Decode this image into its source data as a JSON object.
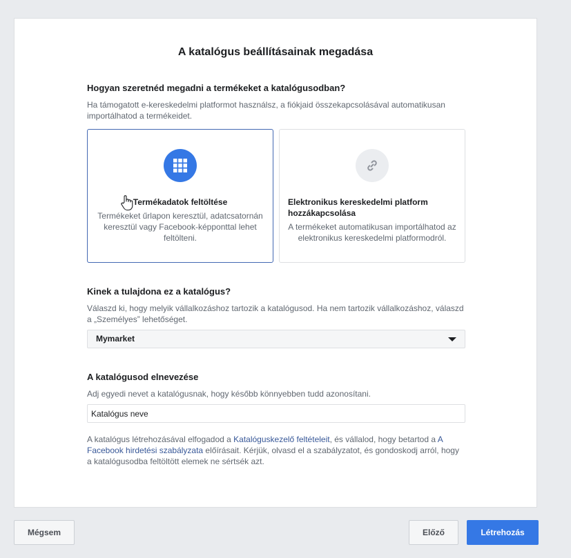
{
  "dialog": {
    "title": "A katalógus beállításainak megadása"
  },
  "products_section": {
    "heading": "Hogyan szeretnéd megadni a termékeket a katalógusodban?",
    "description": "Ha támogatott e-kereskedelmi platformot használsz, a fiókjaid összekapcsolásával automatikusan importálhatod a termékeidet.",
    "options": [
      {
        "title": "Termékadatok feltöltése",
        "description": "Termékeket űrlapon keresztül, adatcsatornán keresztül vagy Facebook-képponttal lehet feltölteni.",
        "icon": "grid-icon",
        "selected": true
      },
      {
        "title": "Elektronikus kereskedelmi platform hozzákapcsolása",
        "description": "A termékeket automatikusan importálhatod az elektronikus kereskedelmi platformodról.",
        "icon": "link-icon",
        "selected": false
      }
    ]
  },
  "owner_section": {
    "heading": "Kinek a tulajdona ez a katalógus?",
    "description": "Válaszd ki, hogy melyik vállalkozáshoz tartozik a katalógusod. Ha nem tartozik vállalkozáshoz, válaszd a „Személyes” lehetőséget.",
    "selected_value": "Mymarket"
  },
  "name_section": {
    "heading": "A katalógusod elnevezése",
    "description": "Adj egyedi nevet a katalógusnak, hogy később könnyebben tudd azonosítani.",
    "input_value": "Katalógus neve"
  },
  "terms": {
    "text_1": "A katalógus létrehozásával elfogadod a ",
    "link_1": "Katalóguskezelő feltételeit",
    "text_2": ", és vállalod, hogy betartod a ",
    "link_2": "A Facebook hirdetési szabályzata",
    "text_3": " előírásait. Kérjük, olvasd el a szabályzatot, és gondoskodj arról, hogy a katalógusodba feltöltött elemek ne sértsék azt."
  },
  "footer": {
    "cancel_label": "Mégsem",
    "back_label": "Előző",
    "create_label": "Létrehozás"
  },
  "colors": {
    "primary": "#3578e5",
    "selected_border": "#4267b2",
    "link": "#385898"
  }
}
